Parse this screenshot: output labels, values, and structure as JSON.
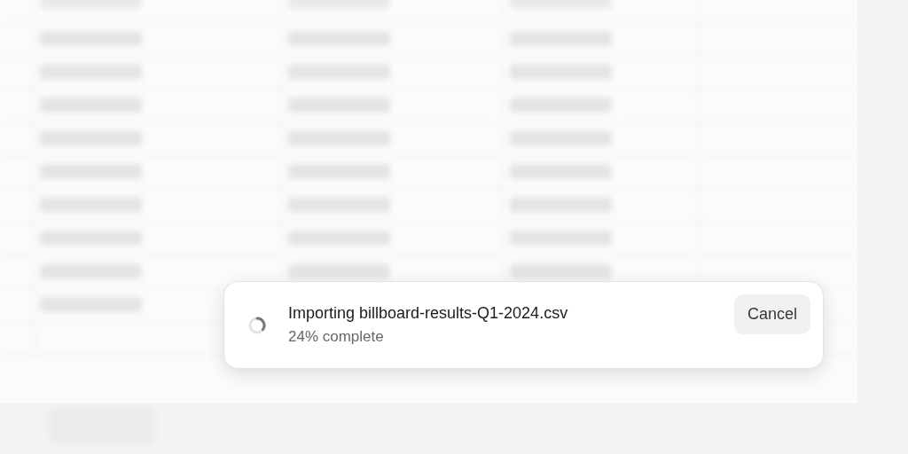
{
  "import_toast": {
    "title": "Importing billboard-results-Q1-2024.csv",
    "progress_text": "24% complete",
    "cancel_button": "Cancel"
  }
}
